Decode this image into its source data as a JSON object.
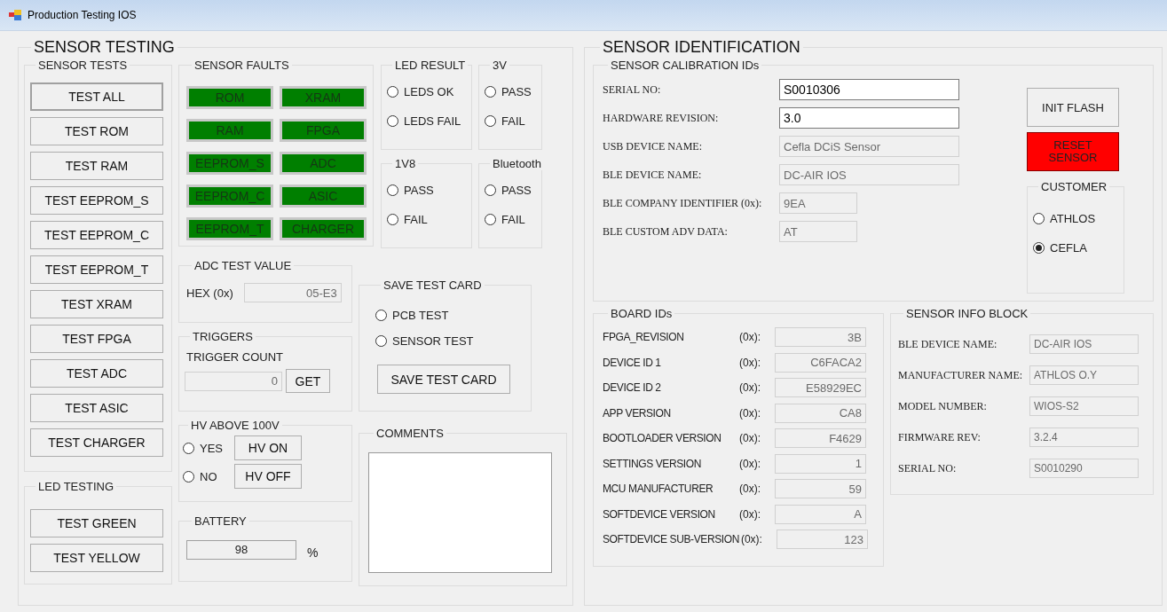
{
  "window": {
    "title": "Production Testing IOS"
  },
  "sensor_testing": {
    "title": "SENSOR TESTING",
    "sensor_tests": {
      "title": "SENSOR TESTS",
      "buttons": [
        {
          "label": "TEST ALL",
          "focused": true
        },
        {
          "label": "TEST ROM",
          "focused": false
        },
        {
          "label": "TEST RAM",
          "focused": false
        },
        {
          "label": "TEST EEPROM_S",
          "focused": false
        },
        {
          "label": "TEST EEPROM_C",
          "focused": false
        },
        {
          "label": "TEST EEPROM_T",
          "focused": false
        },
        {
          "label": "TEST XRAM",
          "focused": false
        },
        {
          "label": "TEST FPGA",
          "focused": false
        },
        {
          "label": "TEST ADC",
          "focused": false
        },
        {
          "label": "TEST ASIC",
          "focused": false
        },
        {
          "label": "TEST CHARGER",
          "focused": false
        }
      ]
    },
    "led_testing": {
      "title": "LED TESTING",
      "buttons": [
        "TEST GREEN",
        "TEST YELLOW"
      ]
    },
    "sensor_faults": {
      "title": "SENSOR FAULTS",
      "indicators": [
        {
          "label": "ROM",
          "color": "#007f00"
        },
        {
          "label": "XRAM",
          "color": "#007f00"
        },
        {
          "label": "RAM",
          "color": "#007f00"
        },
        {
          "label": "FPGA",
          "color": "#007f00"
        },
        {
          "label": "EEPROM_S",
          "color": "#007f00"
        },
        {
          "label": "ADC",
          "color": "#007f00"
        },
        {
          "label": "EEPROM_C",
          "color": "#007f00"
        },
        {
          "label": "ASIC",
          "color": "#007f00"
        },
        {
          "label": "EEPROM_T",
          "color": "#007f00"
        },
        {
          "label": "CHARGER",
          "color": "#007f00"
        }
      ]
    },
    "radio_groups": [
      {
        "title": "LED RESULT",
        "options": [
          {
            "label": "LEDS OK",
            "selected": false
          },
          {
            "label": "LEDS FAIL",
            "selected": false
          }
        ]
      },
      {
        "title": "3V",
        "options": [
          {
            "label": "PASS",
            "selected": false
          },
          {
            "label": "FAIL",
            "selected": false
          }
        ]
      },
      {
        "title": "1V8",
        "options": [
          {
            "label": "PASS",
            "selected": false
          },
          {
            "label": "FAIL",
            "selected": false
          }
        ]
      },
      {
        "title": "Bluetooth",
        "options": [
          {
            "label": "PASS",
            "selected": false
          },
          {
            "label": "FAIL",
            "selected": false
          }
        ]
      }
    ],
    "adc_test_value": {
      "title": "ADC TEST VALUE",
      "label": "HEX (0x)",
      "value": "05-E3"
    },
    "triggers": {
      "title": "TRIGGERS",
      "label": "TRIGGER COUNT",
      "value": "0",
      "button": "GET"
    },
    "hv": {
      "title": "HV ABOVE 100V",
      "options": [
        {
          "label": "YES",
          "selected": false,
          "button": "HV ON"
        },
        {
          "label": "NO",
          "selected": false,
          "button": "HV OFF"
        }
      ]
    },
    "battery": {
      "title": "BATTERY",
      "value": "98",
      "unit": "%"
    },
    "save_test_card": {
      "title": "SAVE TEST CARD",
      "options": [
        {
          "label": "PCB TEST",
          "selected": false
        },
        {
          "label": "SENSOR TEST",
          "selected": false
        }
      ],
      "button": "SAVE TEST CARD"
    },
    "comments": {
      "title": "COMMENTS"
    }
  },
  "sensor_identification": {
    "title": "SENSOR IDENTIFICATION",
    "calibration": {
      "title": "SENSOR CALIBRATION IDs",
      "fields": [
        {
          "label": "SERIAL NO:",
          "value": "S0010306",
          "disabled": false,
          "kind": "long"
        },
        {
          "label": "HARDWARE REVISION:",
          "value": "3.0",
          "disabled": false,
          "kind": "long"
        },
        {
          "label": "USB DEVICE NAME:",
          "value": "Cefla DCiS Sensor",
          "disabled": true,
          "kind": "long"
        },
        {
          "label": "BLE DEVICE NAME:",
          "value": "DC-AIR IOS",
          "disabled": true,
          "kind": "long"
        },
        {
          "label": "BLE COMPANY IDENTIFIER (0x):",
          "value": "9EA",
          "disabled": true,
          "kind": "short"
        },
        {
          "label": "BLE CUSTOM ADV DATA:",
          "value": "AT",
          "disabled": true,
          "kind": "short"
        }
      ],
      "buttons": [
        {
          "label": "INIT FLASH",
          "kind": "normal"
        },
        {
          "label": "RESET SENSOR",
          "kind": "danger"
        }
      ],
      "customer": {
        "title": "CUSTOMER",
        "options": [
          {
            "label": "ATHLOS",
            "selected": false
          },
          {
            "label": "CEFLA",
            "selected": true
          }
        ]
      }
    },
    "board_ids": {
      "title": "BOARD IDs",
      "rows": [
        {
          "label": "FPGA_REVISION",
          "unit": "(0x):",
          "value": "3B"
        },
        {
          "label": "DEVICE ID 1",
          "unit": "(0x):",
          "value": "C6FACA2"
        },
        {
          "label": "DEVICE ID 2",
          "unit": "(0x):",
          "value": "E58929EC"
        },
        {
          "label": "APP VERSION",
          "unit": "(0x):",
          "value": "CA8"
        },
        {
          "label": "BOOTLOADER VERSION",
          "unit": "(0x):",
          "value": "F4629"
        },
        {
          "label": "SETTINGS VERSION",
          "unit": "(0x):",
          "value": "1"
        },
        {
          "label": "MCU MANUFACTURER",
          "unit": "(0x):",
          "value": "59"
        },
        {
          "label": "SOFTDEVICE VERSION",
          "unit": "(0x):",
          "value": "A"
        },
        {
          "label": "SOFTDEVICE SUB-VERSION",
          "unit": "(0x):",
          "value": "123"
        }
      ]
    },
    "sensor_info": {
      "title": "SENSOR INFO BLOCK",
      "rows": [
        {
          "label": "BLE DEVICE NAME:",
          "value": "DC-AIR IOS"
        },
        {
          "label": "MANUFACTURER NAME:",
          "value": "ATHLOS O.Y"
        },
        {
          "label": "MODEL NUMBER:",
          "value": "WIOS-S2"
        },
        {
          "label": "FIRMWARE REV:",
          "value": "3.2.4"
        },
        {
          "label": "SERIAL NO:",
          "value": "S0010290"
        }
      ]
    }
  }
}
